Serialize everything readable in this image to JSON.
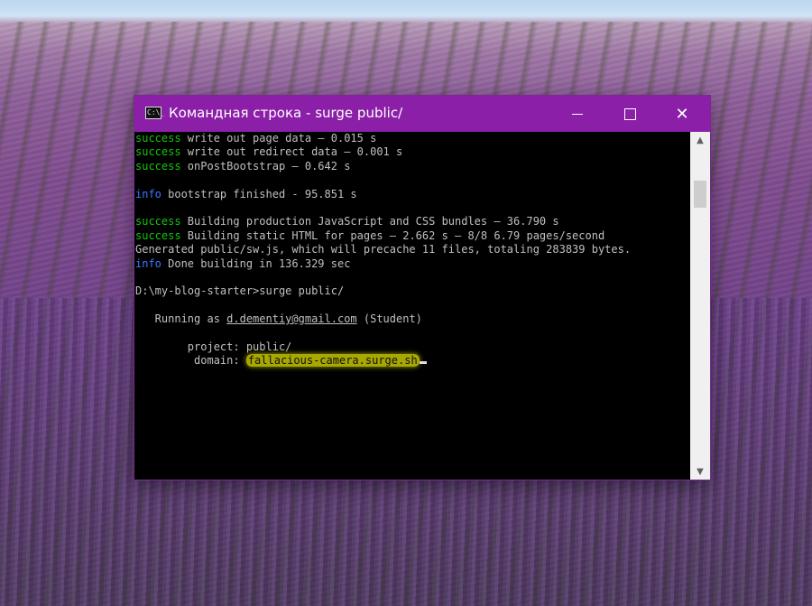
{
  "window": {
    "title": "Командная строка - surge  public/",
    "icon_label": "C:\\_",
    "controls": {
      "minimize": "minimize-icon",
      "maximize": "maximize-icon",
      "close": "✕"
    }
  },
  "colors": {
    "titlebar": "#8b1fa8",
    "success": "#16c60c",
    "info": "#3b78ff",
    "highlight": "#a8a800"
  },
  "console": {
    "lines": [
      {
        "tag": "success",
        "text": " write out page data — 0.015 s"
      },
      {
        "tag": "success",
        "text": " write out redirect data — 0.001 s"
      },
      {
        "tag": "success",
        "text": " onPostBootstrap — 0.642 s"
      },
      {
        "tag": "",
        "text": ""
      },
      {
        "tag": "info",
        "text": " bootstrap finished - 95.851 s"
      },
      {
        "tag": "",
        "text": ""
      },
      {
        "tag": "success",
        "text": " Building production JavaScript and CSS bundles — 36.790 s"
      },
      {
        "tag": "success",
        "text": " Building static HTML for pages — 2.662 s — 8/8 6.79 pages/second"
      },
      {
        "tag": "",
        "text": "Generated public/sw.js, which will precache 11 files, totaling 283839 bytes."
      },
      {
        "tag": "info",
        "text": " Done building in 136.329 sec"
      },
      {
        "tag": "",
        "text": ""
      },
      {
        "tag": "",
        "text": "D:\\my-blog-starter>surge public/"
      },
      {
        "tag": "",
        "text": ""
      }
    ],
    "running_prefix": "   Running as ",
    "running_email": "d.dementiy@gmail.com",
    "running_suffix": " (Student)",
    "project_label": "        project: ",
    "project_value": "public/",
    "domain_label": "         domain: ",
    "domain_value": "fallacious-camera.surge.sh"
  }
}
